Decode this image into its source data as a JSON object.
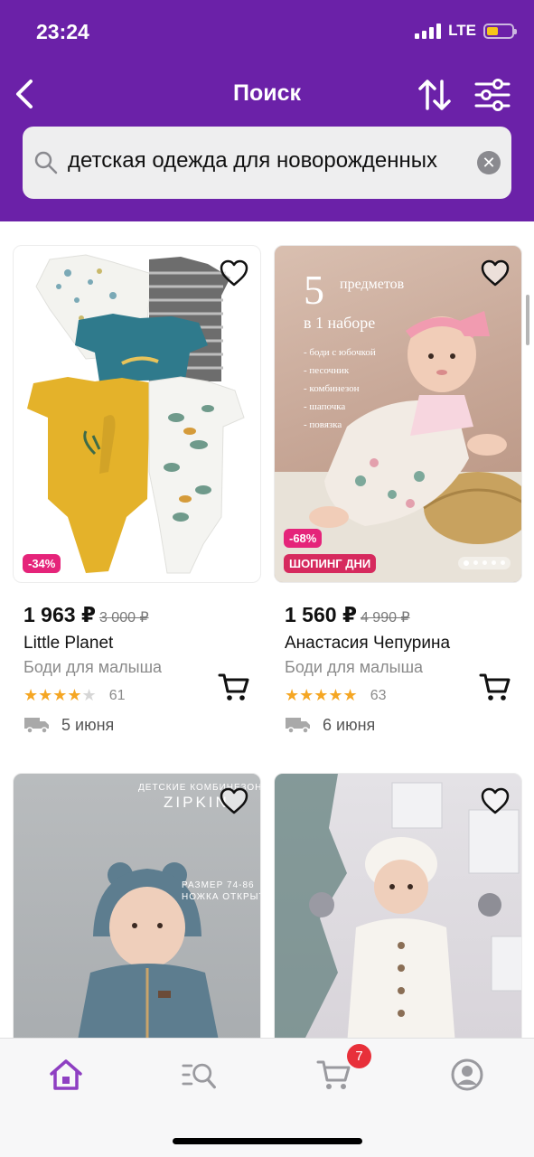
{
  "status_bar": {
    "time": "23:24",
    "network": "LTE",
    "battery_level": 0.45
  },
  "nav": {
    "title": "Поиск",
    "back_icon": "chevron-left-icon",
    "sort_icon": "sort-arrows-icon",
    "filter_icon": "sliders-icon"
  },
  "search": {
    "value": "детская одежда для новорожденных",
    "icon": "search-icon",
    "clear_icon": "close-icon"
  },
  "colors": {
    "brand": "#6b21a8",
    "badge_pink": "#e5247a",
    "badge_red": "#d62a5e",
    "star": "#f5a623",
    "cart_badge": "#e8303a"
  },
  "products": [
    {
      "discount": "-34%",
      "promo": "",
      "price": "1 963 ₽",
      "old_price": "3 000 ₽",
      "seller": "Little Planet",
      "category": "Боди для малыша",
      "rating": 4,
      "reviews": "61",
      "delivery": "5 июня",
      "image_text": []
    },
    {
      "discount": "-68%",
      "promo": "ШОПИНГ ДНИ",
      "price": "1 560 ₽",
      "old_price": "4 990 ₽",
      "seller": "Анастасия Чепурина",
      "category": "Боди для малыша",
      "rating": 5,
      "reviews": "63",
      "delivery": "6 июня",
      "image_text": [
        "5",
        "предметов",
        "в 1 наборе",
        "- боди с юбочкой",
        "- песочник",
        "- комбинезон",
        "- шапочка",
        "- повязка"
      ]
    },
    {
      "image_text": [
        "ДЕТСКИЕ КОМБИНЕЗОНЫ",
        "ZIPKIN",
        "РАЗМЕР 74-86",
        "НОЖКА ОТКРЫТА"
      ]
    },
    {
      "image_text": []
    }
  ],
  "tabbar": {
    "items": [
      "home-icon",
      "catalog-search-icon",
      "cart-icon",
      "profile-icon"
    ],
    "cart_count": "7"
  }
}
